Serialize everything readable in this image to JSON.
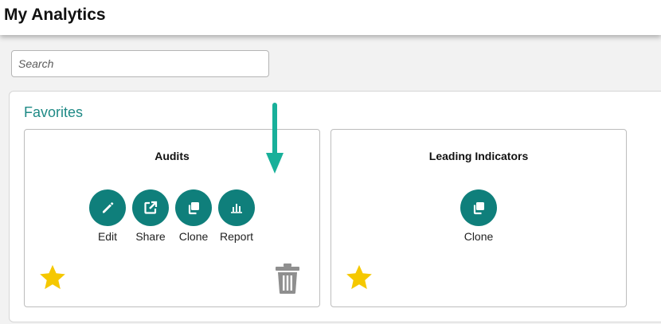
{
  "header": {
    "title": "My Analytics"
  },
  "search": {
    "placeholder": "Search",
    "value": ""
  },
  "favorites": {
    "title": "Favorites",
    "cards": [
      {
        "title": "Audits",
        "actions": [
          {
            "label": "Edit",
            "icon": "pencil-icon"
          },
          {
            "label": "Share",
            "icon": "external-link-icon"
          },
          {
            "label": "Clone",
            "icon": "copy-icon"
          },
          {
            "label": "Report",
            "icon": "bar-chart-icon"
          }
        ],
        "favorite": true,
        "deletable": true
      },
      {
        "title": "Leading Indicators",
        "actions": [
          {
            "label": "Clone",
            "icon": "copy-icon"
          }
        ],
        "favorite": true,
        "deletable": false
      }
    ]
  },
  "colors": {
    "accent": "#0f7f7b",
    "favorites_title": "#1f8a86",
    "star": "#f5c800",
    "trash": "#8f8f8f",
    "annotation_arrow": "#18b09a"
  }
}
